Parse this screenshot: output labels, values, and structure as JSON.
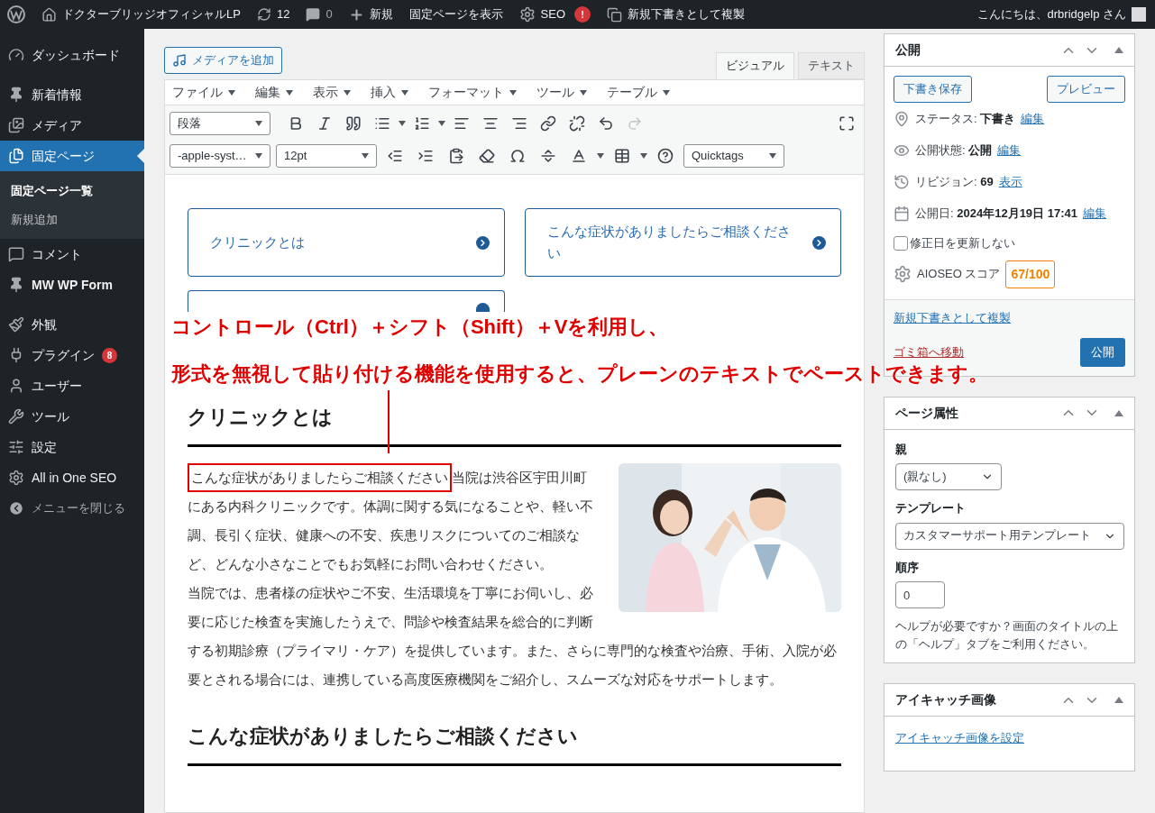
{
  "admin_bar": {
    "site_name": "ドクターブリッジオフィシャルLP",
    "updates": "12",
    "comments": "0",
    "new": "新規",
    "view_page": "固定ページを表示",
    "seo": "SEO",
    "seo_alert": "!",
    "duplicate": "新規下書きとして複製",
    "greeting": "こんにちは、drbridgelp さん"
  },
  "sidebar": {
    "items": [
      {
        "label": "ダッシュボード",
        "selected": false
      },
      {
        "label": "新着情報",
        "selected": false
      },
      {
        "label": "メディア",
        "selected": false
      },
      {
        "label": "固定ページ",
        "selected": true,
        "children": [
          {
            "label": "固定ページ一覧",
            "selected": true
          },
          {
            "label": "新規追加",
            "selected": false
          }
        ]
      },
      {
        "label": "コメント",
        "selected": false
      },
      {
        "label": "MW WP Form",
        "selected": false
      },
      {
        "label": "外観",
        "selected": false
      },
      {
        "label": "プラグイン",
        "selected": false,
        "badge": "8"
      },
      {
        "label": "ユーザー",
        "selected": false
      },
      {
        "label": "ツール",
        "selected": false
      },
      {
        "label": "設定",
        "selected": false
      },
      {
        "label": "All in One SEO",
        "selected": false
      }
    ],
    "collapse": "メニューを閉じる"
  },
  "editor": {
    "add_media": "メディアを追加",
    "tabs": [
      {
        "label": "ビジュアル",
        "selected": true
      },
      {
        "label": "テキスト",
        "selected": false
      }
    ],
    "menus": [
      "ファイル",
      "編集",
      "表示",
      "挿入",
      "フォーマット",
      "ツール",
      "テーブル"
    ],
    "format_select": "段落",
    "font_select": "-apple-syst…",
    "size_select": "12pt",
    "quicktags": "Quicktags",
    "cards": [
      {
        "title": "クリニックとは"
      },
      {
        "title": "こんな症状がありましたらご相談ください"
      },
      {
        "kind": "covered"
      }
    ],
    "heading_1": "クリニックとは",
    "intro_highlight": "こんな症状がありましたらご相談ください",
    "intro_text": "当院は渋谷区宇田川町にある内科クリニックです。体調に関する気になることや、軽い不調、長引く症状、健康への不安、疾患リスクについてのご相談など、どんな小さなことでもお気軽にお問い合わせください。",
    "paragraph": "当院では、患者様の症状やご不安、生活環境を丁寧にお伺いし、必要に応じた検査を実施したうえで、問診や検査結果を総合的に判断する初期診療（プライマリ・ケア）を提供しています。また、さらに専門的な検査や治療、手術、入院が必要とされる場合には、連携している高度医療機関をご紹介し、スムーズな対応をサポートします。",
    "heading_2": "こんな症状がありましたらご相談ください"
  },
  "annotation": {
    "lines": [
      "コントロール（Ctrl）＋シフト（Shift）＋Vを利用し、",
      "形式を無視して貼り付ける機能を使用すると、プレーンのテキストでペーストできます。"
    ]
  },
  "publish": {
    "title": "公開",
    "save_draft": "下書き保存",
    "preview": "プレビュー",
    "rows": [
      {
        "label": "ステータス:",
        "value": "下書き",
        "link": "編集"
      },
      {
        "label": "公開状態:",
        "value": "公開",
        "link": "編集"
      },
      {
        "label": "リビジョン:",
        "value": "69",
        "link": "表示"
      },
      {
        "label": "公開日:",
        "value": "2024年12月19日 17:41",
        "link": "編集"
      }
    ],
    "no_update": {
      "label": "修正日を更新しない",
      "checked": false
    },
    "seo_label": "AIOSEO スコア",
    "seo_score": "67/100",
    "duplicate": "新規下書きとして複製",
    "trash": "ゴミ箱へ移動",
    "publish": "公開"
  },
  "page_attributes": {
    "title": "ページ属性",
    "parent_label": "親",
    "parent_value": "(親なし)",
    "template_label": "テンプレート",
    "template_value": "カスタマーサポート用テンプレート",
    "order_label": "順序",
    "order_value": "0",
    "help": "ヘルプが必要ですか？画面のタイトルの上の「ヘルプ」タブをご利用ください。"
  },
  "featured_image": {
    "title": "アイキャッチ画像",
    "link": "アイキャッチ画像を設定"
  }
}
